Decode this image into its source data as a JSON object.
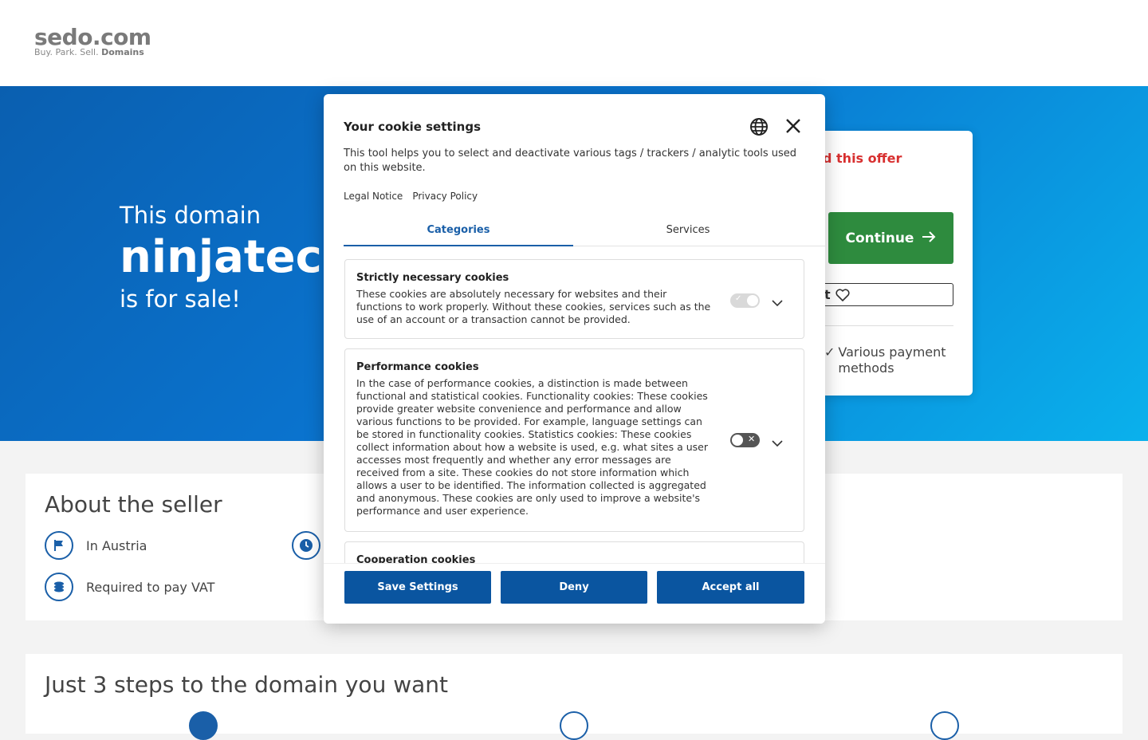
{
  "header": {
    "logo_main": "sedo.com",
    "logo_tag_plain": "Buy.  Park.  Sell.",
    "logo_tag_bold": "Domains"
  },
  "hero": {
    "line1": "This domain",
    "domain": "ninjatec",
    "line3": "is for sale!"
  },
  "offer": {
    "title": "d this offer",
    "continue_label": "Continue",
    "watch_label": "t",
    "payment_label": "Various payment methods"
  },
  "seller": {
    "title": "About the seller",
    "location": "In Austria",
    "vat": "Required to pay VAT"
  },
  "steps": {
    "title": "Just 3 steps to the domain you want"
  },
  "cookie": {
    "title": "Your cookie settings",
    "description": "This tool helps you to select and deactivate various tags / trackers / analytic tools used on this website.",
    "legal_notice": "Legal Notice",
    "privacy_policy": "Privacy Policy",
    "tabs": [
      {
        "label": "Categories"
      },
      {
        "label": "Services"
      }
    ],
    "categories": [
      {
        "title": "Strictly necessary cookies",
        "text": "These cookies are absolutely necessary for websites and their functions to work properly. Without these cookies, services such as the use of an account or a transaction cannot be provided."
      },
      {
        "title": "Performance cookies",
        "text": "In the case of performance cookies, a distinction is made between functional and statistical cookies. Functionality cookies: These cookies provide greater website convenience and performance and allow various functions to be provided. For example, language settings can be stored in functionality cookies. Statistics cookies: These cookies collect information about how a website is used, e.g. what sites a user accesses most frequently and whether any error messages are received from a site. These cookies do not store information which allows a user to be identified. The information collected is aggregated and anonymous. These cookies are only used to improve a website's performance and user experience."
      },
      {
        "title": "Cooperation cookies"
      }
    ],
    "buttons": {
      "save": "Save Settings",
      "deny": "Deny",
      "accept": "Accept all"
    }
  },
  "colors": {
    "brand_blue": "#0a55a0",
    "continue_green": "#2e8b3e",
    "offer_red": "#d83030"
  }
}
